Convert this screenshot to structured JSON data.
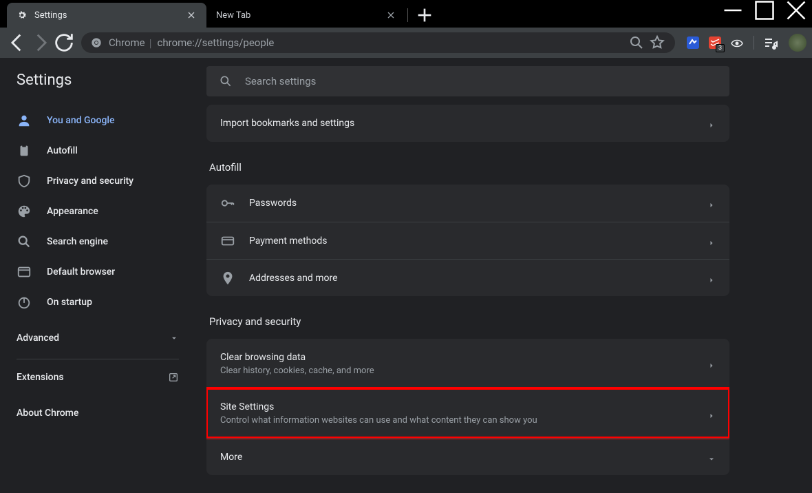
{
  "tabs": [
    {
      "label": "Settings",
      "active": true
    },
    {
      "label": "New Tab",
      "active": false
    }
  ],
  "omnibox": {
    "chrome_label": "Chrome",
    "url": "chrome://settings/people"
  },
  "ext_badge": "3",
  "sidebar": {
    "title": "Settings",
    "items": [
      {
        "label": "You and Google"
      },
      {
        "label": "Autofill"
      },
      {
        "label": "Privacy and security"
      },
      {
        "label": "Appearance"
      },
      {
        "label": "Search engine"
      },
      {
        "label": "Default browser"
      },
      {
        "label": "On startup"
      }
    ],
    "advanced": "Advanced",
    "extensions": "Extensions",
    "about": "About Chrome"
  },
  "search": {
    "placeholder": "Search settings"
  },
  "top_card": {
    "import": "Import bookmarks and settings"
  },
  "sections": {
    "autofill": {
      "title": "Autofill",
      "rows": [
        {
          "title": "Passwords"
        },
        {
          "title": "Payment methods"
        },
        {
          "title": "Addresses and more"
        }
      ]
    },
    "privacy": {
      "title": "Privacy and security",
      "rows": [
        {
          "title": "Clear browsing data",
          "sub": "Clear history, cookies, cache, and more"
        },
        {
          "title": "Site Settings",
          "sub": "Control what information websites can use and what content they can show you"
        },
        {
          "title": "More"
        }
      ]
    }
  }
}
